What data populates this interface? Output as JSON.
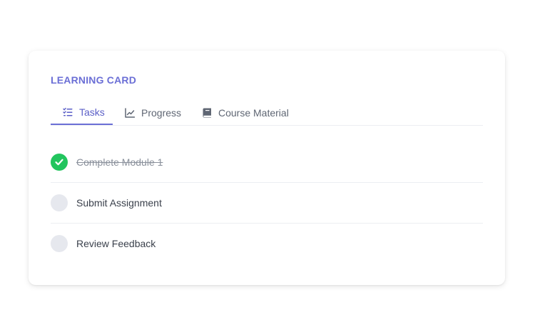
{
  "card": {
    "title": "LEARNING CARD"
  },
  "tabs": [
    {
      "label": "Tasks",
      "icon": "task-list-icon",
      "active": true
    },
    {
      "label": "Progress",
      "icon": "chart-line-icon",
      "active": false
    },
    {
      "label": "Course Material",
      "icon": "book-icon",
      "active": false
    }
  ],
  "tasks": [
    {
      "label": "Complete Module 1",
      "completed": true
    },
    {
      "label": "Submit Assignment",
      "completed": false
    },
    {
      "label": "Review Feedback",
      "completed": false
    }
  ],
  "colors": {
    "accent": "#6b6fd6",
    "success": "#22c55e",
    "unchecked": "#e6e8ee"
  }
}
